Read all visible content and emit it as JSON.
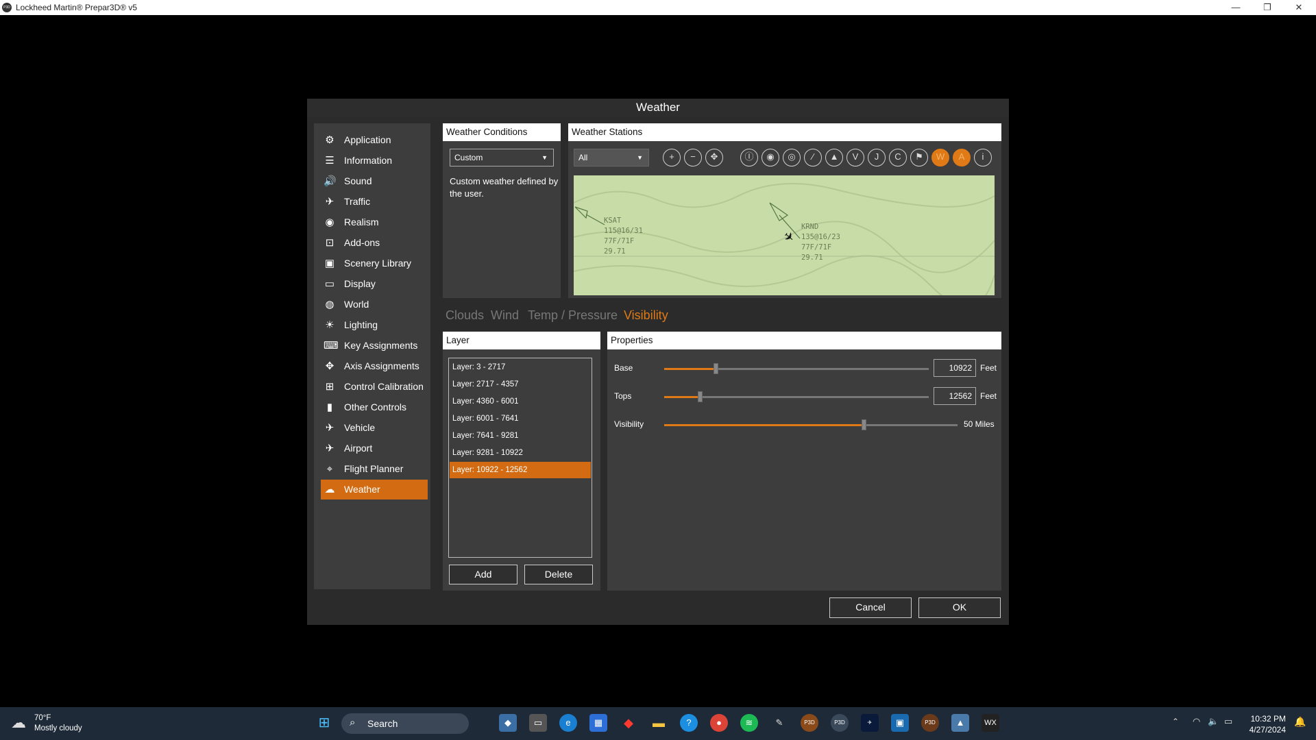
{
  "window": {
    "title": "Lockheed Martin® Prepar3D® v5",
    "icon": "P3D",
    "minimize": "—",
    "maximize": "❐",
    "close": "✕"
  },
  "dialog": {
    "title": "Weather",
    "sidebar": [
      {
        "label": "Application",
        "icon": "gear-icon",
        "glyph": "⚙"
      },
      {
        "label": "Information",
        "icon": "list-icon",
        "glyph": "☰"
      },
      {
        "label": "Sound",
        "icon": "speaker-icon",
        "glyph": "🔊"
      },
      {
        "label": "Traffic",
        "icon": "traffic-plane-icon",
        "glyph": "✈"
      },
      {
        "label": "Realism",
        "icon": "realism-icon",
        "glyph": "◉"
      },
      {
        "label": "Add-ons",
        "icon": "addons-icon",
        "glyph": "⊡"
      },
      {
        "label": "Scenery Library",
        "icon": "scenery-icon",
        "glyph": "▣"
      },
      {
        "label": "Display",
        "icon": "monitor-icon",
        "glyph": "▭"
      },
      {
        "label": "World",
        "icon": "globe-icon",
        "glyph": "◍"
      },
      {
        "label": "Lighting",
        "icon": "lighting-icon",
        "glyph": "☀"
      },
      {
        "label": "Key Assignments",
        "icon": "keyboard-icon",
        "glyph": "⌨"
      },
      {
        "label": "Axis Assignments",
        "icon": "joystick-icon",
        "glyph": "✥"
      },
      {
        "label": "Control Calibration",
        "icon": "calibration-icon",
        "glyph": "⊞"
      },
      {
        "label": "Other Controls",
        "icon": "controls-icon",
        "glyph": "▮"
      },
      {
        "label": "Vehicle",
        "icon": "vehicle-icon",
        "glyph": "✈"
      },
      {
        "label": "Airport",
        "icon": "airport-icon",
        "glyph": "✈"
      },
      {
        "label": "Flight Planner",
        "icon": "flight-planner-icon",
        "glyph": "⌖"
      },
      {
        "label": "Weather",
        "icon": "weather-icon",
        "glyph": "☁"
      }
    ],
    "active_item": "Weather",
    "conditions": {
      "header": "Weather Conditions",
      "selected": "Custom",
      "description": "Custom weather defined by the user."
    },
    "stations": {
      "header": "Weather Stations",
      "filter": "All",
      "tools": [
        {
          "name": "zoom-in-icon",
          "glyph": "+"
        },
        {
          "name": "zoom-out-icon",
          "glyph": "−"
        },
        {
          "name": "center-icon",
          "glyph": "✥"
        },
        {
          "name": "vor-icon",
          "glyph": "Ⓘ"
        },
        {
          "name": "ndb-icon",
          "glyph": "◉"
        },
        {
          "name": "ils-icon",
          "glyph": "◎"
        },
        {
          "name": "runway-icon",
          "glyph": "∕"
        },
        {
          "name": "waypoint-icon",
          "glyph": "▲"
        },
        {
          "name": "victor-airway-icon",
          "glyph": "V"
        },
        {
          "name": "jet-airway-icon",
          "glyph": "J"
        },
        {
          "name": "terrain-icon",
          "glyph": "C"
        },
        {
          "name": "wind-icon",
          "glyph": "⚑"
        },
        {
          "name": "weather-overlay-icon",
          "glyph": "W",
          "active": true
        },
        {
          "name": "airport-overlay-icon",
          "glyph": "A",
          "active": true
        },
        {
          "name": "info-icon",
          "glyph": "i"
        }
      ],
      "map_labels": [
        {
          "id": "KSAT",
          "text": "KSAT\n115@16/31\n77F/71F\n29.71"
        },
        {
          "id": "KRND",
          "text": "KRND\n135@16/23\n77F/71F\n29.71"
        }
      ]
    },
    "tabs": [
      "Clouds",
      "Wind",
      "Temp / Pressure",
      "Visibility"
    ],
    "active_tab": "Visibility",
    "layer": {
      "header": "Layer",
      "items": [
        "Layer: 3 - 2717",
        "Layer: 2717 - 4357",
        "Layer: 4360 - 6001",
        "Layer: 6001 - 7641",
        "Layer: 7641 - 9281",
        "Layer: 9281 - 10922",
        "Layer: 10922 - 12562"
      ],
      "selected_index": 6,
      "add": "Add",
      "delete": "Delete"
    },
    "properties": {
      "header": "Properties",
      "base": {
        "label": "Base",
        "value": "10922",
        "unit": "Feet",
        "fraction": 0.195
      },
      "tops": {
        "label": "Tops",
        "value": "12562",
        "unit": "Feet",
        "fraction": 0.135
      },
      "visibility": {
        "label": "Visibility",
        "value": "50 Miles",
        "fraction": 0.68
      }
    },
    "cancel": "Cancel",
    "ok": "OK"
  },
  "taskbar": {
    "weather_temp": "70°F",
    "weather_desc": "Mostly cloudy",
    "search": "Search",
    "time": "10:32 PM",
    "date": "4/27/2024"
  },
  "colors": {
    "accent": "#d26b12",
    "panel": "#3d3d3d",
    "dialog": "#2b2b2b",
    "map": "#c8dca8"
  }
}
